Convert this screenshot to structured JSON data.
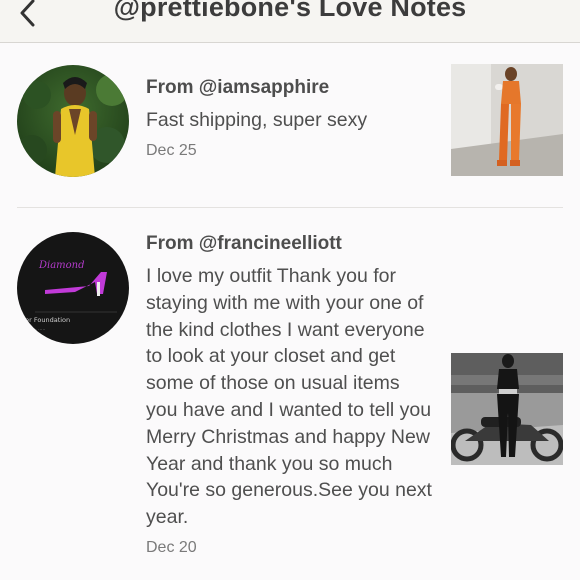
{
  "header": {
    "title": "@prettiebone's Love Notes"
  },
  "notes": [
    {
      "from": "From @iamsapphire",
      "message": "Fast shipping, super sexy",
      "date": "Dec 25"
    },
    {
      "from": "From @francineelliott",
      "message": "I love my outfit Thank you for staying with me with your one of the kind clothes I want everyone to look at your closet and get some of those on usual items you have and I wanted to tell you Merry Christmas and happy New Year and thank you so much You're so generous.See you next year.",
      "date": "Dec 20"
    }
  ],
  "icons": {
    "back": "chevron-left-icon"
  },
  "colors": {
    "header_bg": "#f6f5f2",
    "page_bg": "#fbfafb",
    "text": "#4a4a4a",
    "divider": "#e4e2e0"
  }
}
